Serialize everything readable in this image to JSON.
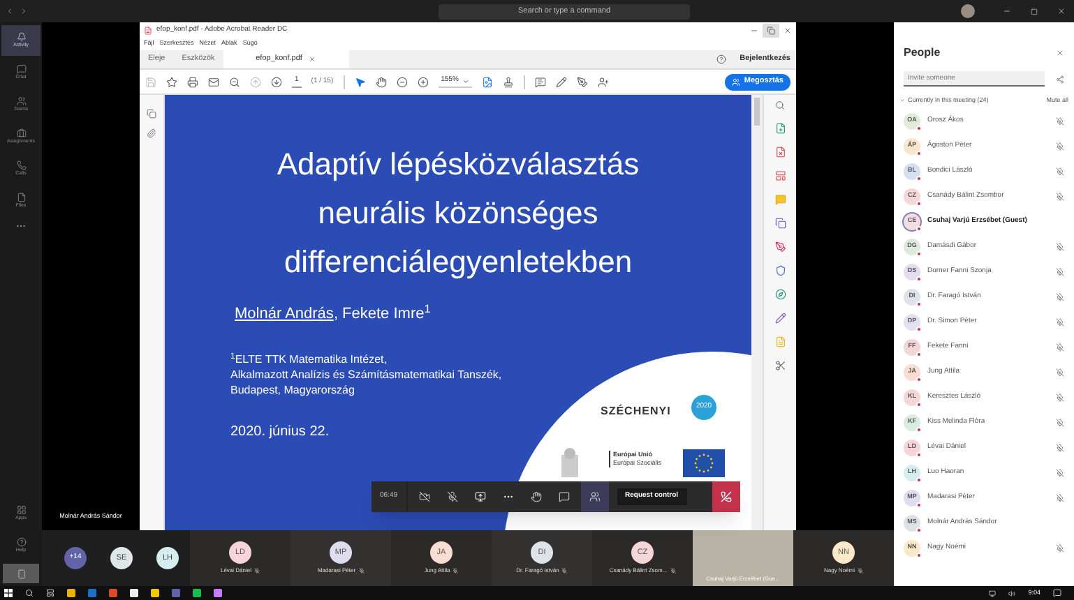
{
  "titlebar": {
    "search": {
      "placeholder": "Search or type a command"
    }
  },
  "rail": {
    "items": [
      {
        "label": "Activity",
        "kind": "activity",
        "selected": true
      },
      {
        "label": "Chat",
        "kind": "chat",
        "selected": false
      },
      {
        "label": "Teams",
        "kind": "teams",
        "selected": false
      },
      {
        "label": "Assignments",
        "kind": "assignments",
        "selected": false
      },
      {
        "label": "Calls",
        "kind": "calls",
        "selected": false
      },
      {
        "label": "Files",
        "kind": "files",
        "selected": false
      }
    ],
    "bottom": [
      {
        "label": "Apps",
        "kind": "apps"
      },
      {
        "label": "Help",
        "kind": "help"
      }
    ]
  },
  "stage": {
    "presenter_name": "Molnár András Sándor"
  },
  "acrobat": {
    "title": "efop_konf.pdf - Adobe Acrobat Reader DC",
    "menu": [
      "Fájl",
      "Szerkesztés",
      "Nézet",
      "Ablak",
      "Súgó"
    ],
    "tabs": [
      {
        "label": "Eleje",
        "selected": false
      },
      {
        "label": "Eszközök",
        "selected": false
      },
      {
        "label": "efop_konf.pdf",
        "selected": true,
        "closable": true
      }
    ],
    "sign_in": "Bejelentkezés",
    "page": "1",
    "page_count": "(1 / 15)",
    "zoom": "155%",
    "share_button": "Megosztás"
  },
  "slide": {
    "title_lines": [
      "Adaptív lépésközválasztás",
      "neurális közönséges",
      "differenciálegyenletekben"
    ],
    "authors": [
      {
        "text": "Molnár András",
        "underlined": true
      },
      {
        "text": ", Fekete Imre$^{1}$",
        "underlined": false
      }
    ],
    "affiliation_lines": [
      "$^{1}$ELTE TTK Matematika Intézet,",
      "Alkalmazott Analízis és Számításmatematikai Tanszék,",
      "Budapest, Magyarország"
    ],
    "date": "2020. június 22.",
    "logo": {
      "name": "SZÉCHENYI",
      "year": "2020",
      "eu_lines": [
        "Európai Unió",
        "Európai Szociális"
      ]
    }
  },
  "meeting_controls": {
    "timer": "06:49",
    "request_control": "Request control"
  },
  "people": {
    "title": "People",
    "invite": {
      "placeholder": "Invite someone"
    },
    "section": "Currently in this meeting (24)",
    "mute_all": "Mute all",
    "participants": [
      {
        "initials": "OA",
        "name": "Orosz Ákos",
        "color": "#e0ecd8",
        "muted": true,
        "highlighted": false
      },
      {
        "initials": "ÁP",
        "name": "Ágoston Péter",
        "color": "#fbe4cc",
        "muted": true,
        "highlighted": false
      },
      {
        "initials": "BL",
        "name": "Bondici László",
        "color": "#d6dff0",
        "muted": true,
        "highlighted": false
      },
      {
        "initials": "CZ",
        "name": "Csanády Bálint Zsombor",
        "color": "#f6d7d9",
        "muted": true,
        "highlighted": false
      },
      {
        "initials": "CE",
        "name": "Csuhaj Varjú Erzsébet (Guest)",
        "color": "#f3dde0",
        "muted": false,
        "highlighted": true
      },
      {
        "initials": "DG",
        "name": "Damásdi Gábor",
        "color": "#dfeadb",
        "muted": true,
        "highlighted": false
      },
      {
        "initials": "DS",
        "name": "Dorner Fanni Szonja",
        "color": "#e2def0",
        "muted": true,
        "highlighted": false
      },
      {
        "initials": "DI",
        "name": "Dr. Faragó István",
        "color": "#dde3e8",
        "muted": true,
        "highlighted": false
      },
      {
        "initials": "DP",
        "name": "Dr. Simon Péter",
        "color": "#e4e0f1",
        "muted": true,
        "highlighted": false
      },
      {
        "initials": "FF",
        "name": "Fekete Fanni",
        "color": "#f3d5d5",
        "muted": true,
        "highlighted": false
      },
      {
        "initials": "JA",
        "name": "Jung Attila",
        "color": "#fbdcd2",
        "muted": true,
        "highlighted": false
      },
      {
        "initials": "KL",
        "name": "Keresztes László",
        "color": "#f5d6d8",
        "muted": true,
        "highlighted": false
      },
      {
        "initials": "KF",
        "name": "Kiss Melinda Flóra",
        "color": "#d8ecdf",
        "muted": true,
        "highlighted": false
      },
      {
        "initials": "LD",
        "name": "Lévai Dániel",
        "color": "#f6d4da",
        "muted": true,
        "highlighted": false
      },
      {
        "initials": "LH",
        "name": "Luo Haoran",
        "color": "#d4eef0",
        "muted": true,
        "highlighted": false
      },
      {
        "initials": "MP",
        "name": "Madarasi Péter",
        "color": "#e0dcef",
        "muted": true,
        "highlighted": false
      },
      {
        "initials": "MS",
        "name": "Molnár András Sándor",
        "color": "#dce2e7",
        "muted": false,
        "highlighted": false
      },
      {
        "initials": "NN",
        "name": "Nagy Noémi",
        "color": "#fbe8c8",
        "muted": true,
        "highlighted": false
      }
    ]
  },
  "gallery": {
    "overflow": "+14",
    "small": [
      {
        "initials": "SE",
        "color": "#dfe6ea"
      },
      {
        "initials": "LH",
        "color": "#d4eef0"
      }
    ],
    "tiles": [
      {
        "kind": "avatar",
        "initials": "LD",
        "name": "Lévai Dániel",
        "color": "#f6d4da"
      },
      {
        "kind": "avatar",
        "initials": "MP",
        "name": "Madarasi Péter",
        "color": "#e0dcef"
      },
      {
        "kind": "avatar",
        "initials": "JA",
        "name": "Jung Attila",
        "color": "#fbdcd2"
      },
      {
        "kind": "avatar",
        "initials": "DI",
        "name": "Dr. Faragó István",
        "color": "#dde3e8"
      },
      {
        "kind": "avatar",
        "initials": "CZ",
        "name": "Csanády Bálint Zsom...",
        "color": "#f6d7d9"
      },
      {
        "kind": "video",
        "name": "Csuhaj Varjú Erzsébet (Gue..."
      },
      {
        "kind": "avatar",
        "initials": "NN",
        "name": "Nagy Noémi",
        "color": "#fbe8c8"
      }
    ]
  },
  "taskbar": {
    "time": "9:04"
  }
}
